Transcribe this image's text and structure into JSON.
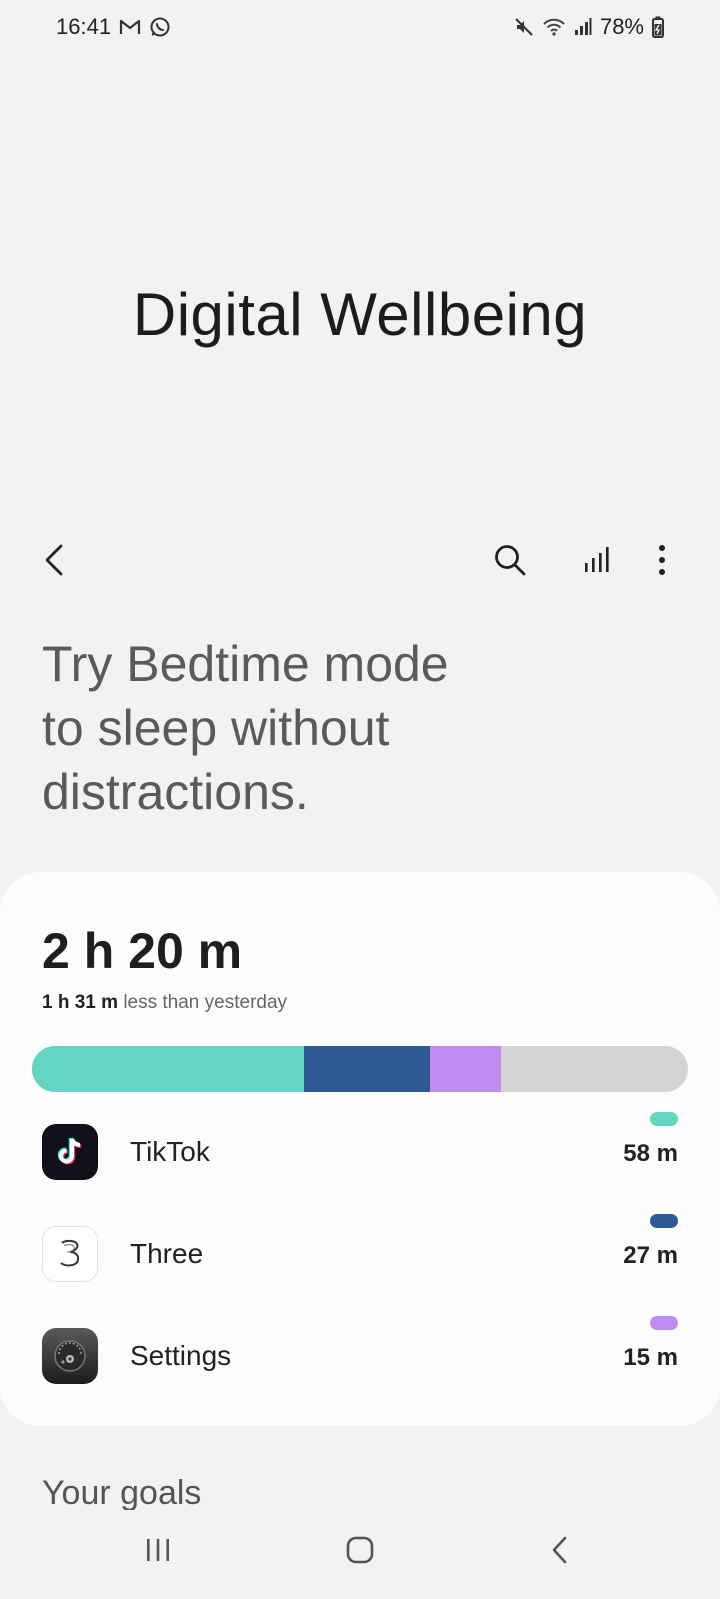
{
  "status_bar": {
    "time": "16:41",
    "battery_percent": "78%",
    "icons_left": [
      "gmail-icon",
      "whatsapp-icon"
    ],
    "icons_right": [
      "mute-icon",
      "wifi-icon",
      "signal-icon",
      "battery-icon"
    ]
  },
  "header": {
    "title": "Digital Wellbeing"
  },
  "toolbar": {
    "icons": [
      "back-icon",
      "search-icon",
      "bar-chart-icon",
      "more-options-icon"
    ]
  },
  "promo": {
    "line1": "Try Bedtime mode",
    "line2": "to sleep without",
    "line3": "distractions."
  },
  "summary": {
    "total_time": "2 h 20 m",
    "comparison_value": "1 h 31 m",
    "comparison_text": "less than yesterday",
    "total_minutes": 140
  },
  "apps": [
    {
      "name": "TikTok",
      "time": "58 m",
      "minutes": 58,
      "color": "#63d5c3",
      "icon": "tiktok-icon"
    },
    {
      "name": "Three",
      "time": "27 m",
      "minutes": 27,
      "color": "#2e5a96",
      "icon": "three-icon"
    },
    {
      "name": "Settings",
      "time": "15 m",
      "minutes": 15,
      "color": "#c08cf0",
      "icon": "settings-app-icon"
    }
  ],
  "usage_bar": {
    "other_color": "#d4d4d4",
    "max_minutes": 140
  },
  "goals": {
    "title": "Your goals"
  },
  "nav_bar": {
    "icons": [
      "recents-icon",
      "home-icon",
      "nav-back-icon"
    ]
  }
}
